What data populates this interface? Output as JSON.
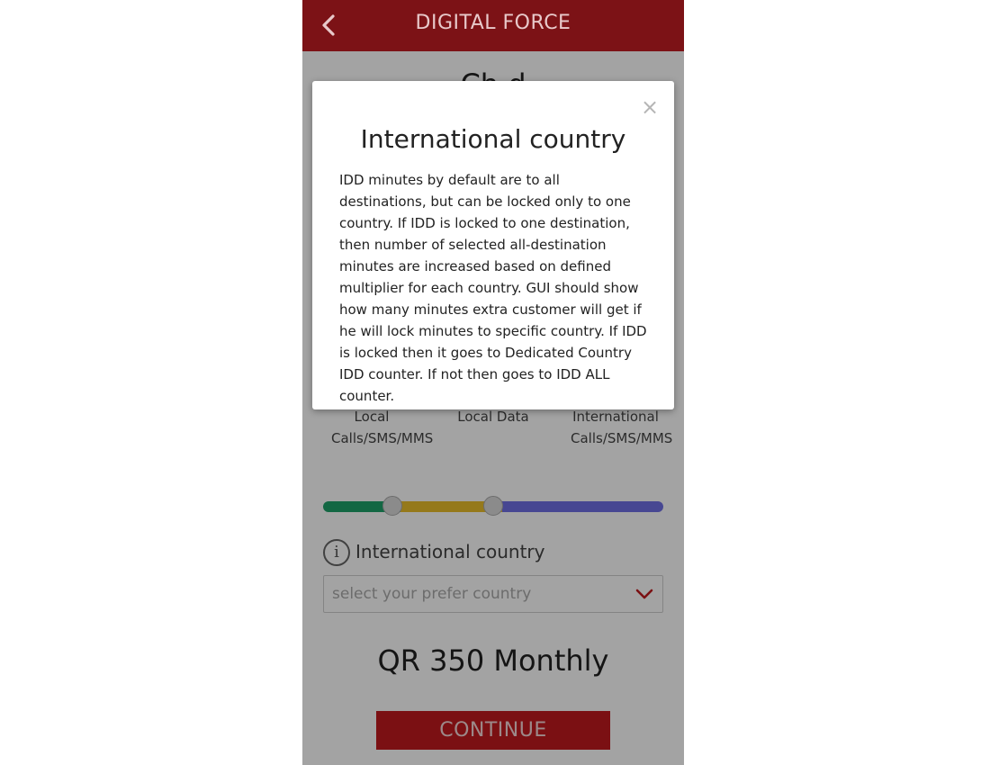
{
  "header": {
    "title": "DIGITAL FORCE",
    "back_icon": "chevron-left-icon"
  },
  "page": {
    "heading_peek": "Ch                              d",
    "labels": [
      "Local Calls/SMS/MMS",
      "Local Data",
      "International Calls/SMS/MMS"
    ],
    "slider": {
      "segments": [
        {
          "name": "local-calls",
          "color": "#1fa269"
        },
        {
          "name": "local-data",
          "color": "#e9be2b"
        },
        {
          "name": "international",
          "color": "#6f6fe4"
        }
      ]
    },
    "international_label": "International country",
    "info_icon": "info-icon",
    "country_select": {
      "placeholder": "select your prefer country",
      "icon": "chevron-down-icon"
    },
    "price": "QR 350 Monthly",
    "continue_label": "CONTINUE"
  },
  "modal": {
    "title": "International country",
    "close_symbol": "×",
    "body": "IDD minutes by default are to all destinations, but can be locked only to one country. If IDD is locked to one destination, then number of selected all-destination minutes are increased based on defined multiplier for each country. GUI should show how many minutes extra customer will get if he will lock minutes to specific country. If IDD is locked then it goes to Dedicated Country IDD counter. If not then goes to IDD ALL counter."
  },
  "colors": {
    "brand": "#7c1216",
    "button": "#c11a1f",
    "accent_chevron": "#c11a1f"
  }
}
